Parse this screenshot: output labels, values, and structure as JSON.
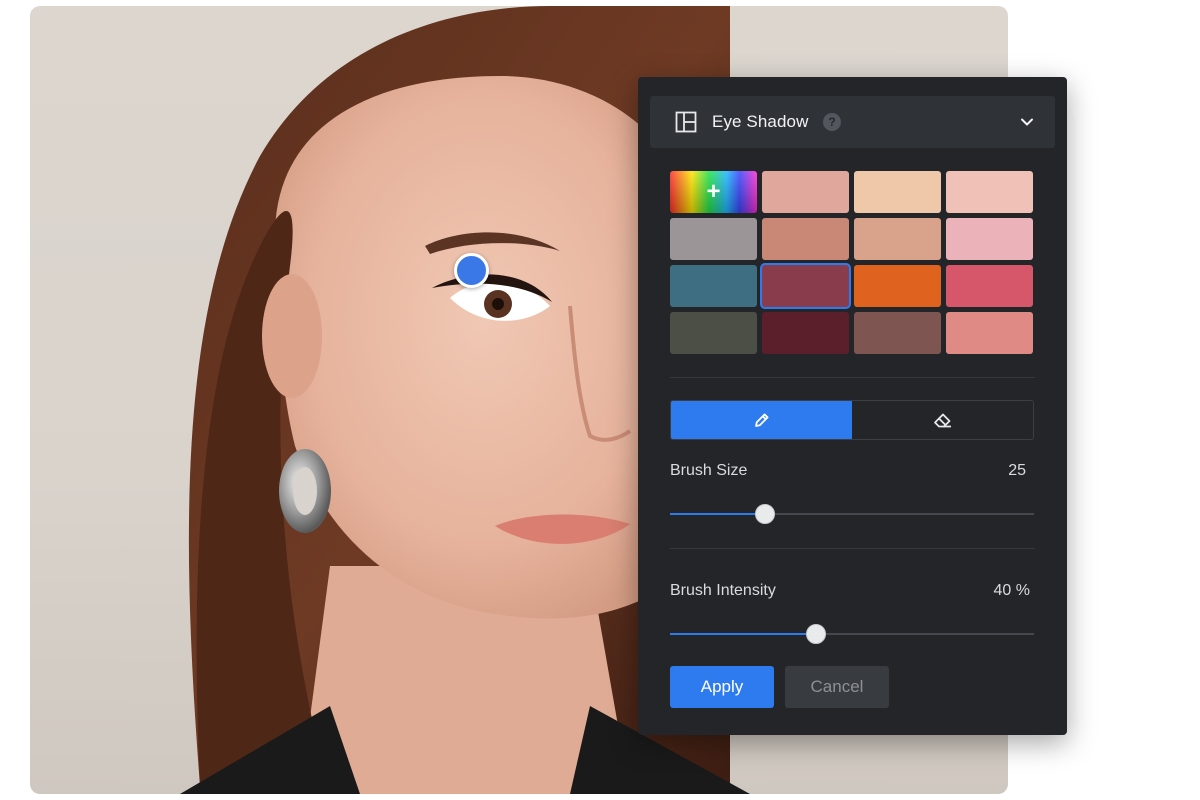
{
  "panel": {
    "title": "Eye Shadow",
    "help_icon": "?",
    "icons": {
      "layout": "layout-icon",
      "help": "help-icon",
      "collapse": "chevron-down-icon",
      "custom_color": "plus-icon",
      "brush": "brush-icon",
      "eraser": "eraser-icon"
    },
    "swatches": [
      {
        "color": "custom-gradient",
        "custom": true,
        "label": "+"
      },
      {
        "color": "#e0a89d"
      },
      {
        "color": "#efc8a9"
      },
      {
        "color": "#f0c1b7"
      },
      {
        "color": "#9c9597"
      },
      {
        "color": "#c98775"
      },
      {
        "color": "#d9a38b"
      },
      {
        "color": "#ecb2ba"
      },
      {
        "color": "#3d6e82"
      },
      {
        "color": "#893c4b",
        "selected": true
      },
      {
        "color": "#e0621f"
      },
      {
        "color": "#d7576a"
      },
      {
        "color": "#4b4f45"
      },
      {
        "color": "#5b1f2c"
      },
      {
        "color": "#7e5551"
      },
      {
        "color": "#e08a85"
      }
    ],
    "tools": {
      "active": "brush"
    },
    "brush_size": {
      "label": "Brush Size",
      "value": "25",
      "fraction": 0.26
    },
    "brush_intensity": {
      "label": "Brush Intensity",
      "value": "40 %",
      "fraction": 0.4
    },
    "apply_label": "Apply",
    "cancel_label": "Cancel",
    "colors": {
      "accent": "#2e7bf0",
      "panel_bg": "#232529",
      "header_bg": "#2f3237"
    }
  },
  "canvas": {
    "brush_cursor_color": "#3b78e7"
  }
}
